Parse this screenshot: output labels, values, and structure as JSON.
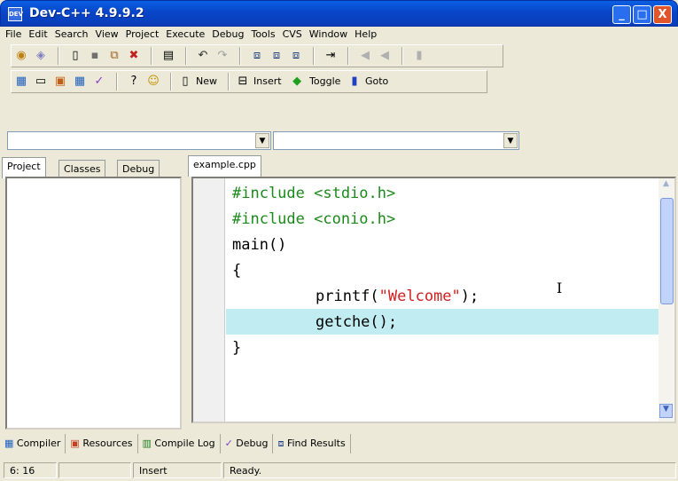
{
  "window": {
    "title": "Dev-C++ 4.9.9.2",
    "icon": "DEV",
    "min": "_",
    "max": "□",
    "close": "X"
  },
  "menu": [
    "File",
    "Edit",
    "Search",
    "View",
    "Project",
    "Execute",
    "Debug",
    "Tools",
    "CVS",
    "Window",
    "Help"
  ],
  "toolbar2": {
    "new_label": "New",
    "insert_label": "Insert",
    "toggle_label": "Toggle",
    "goto_label": "Goto"
  },
  "left_tabs": [
    "Project",
    "Classes",
    "Debug"
  ],
  "editor_tab": "example.cpp",
  "code": {
    "line1": "#include <stdio.h>",
    "line2": "#include <conio.h>",
    "line3": "main()",
    "line4": "{",
    "line5_a": "printf(",
    "line5_str": "\"Welcome\"",
    "line5_b": ");",
    "line6": "getche();",
    "line7": "}"
  },
  "bottom_tabs": [
    "Compiler",
    "Resources",
    "Compile Log",
    "Debug",
    "Find Results"
  ],
  "status": {
    "position": "6: 16",
    "mode": "Insert",
    "message": "Ready."
  },
  "colors": {
    "titlebar": "#0845c8",
    "highlight_line": "#c0ecf2",
    "string": "#d02020",
    "include": "#1a8a1a"
  }
}
